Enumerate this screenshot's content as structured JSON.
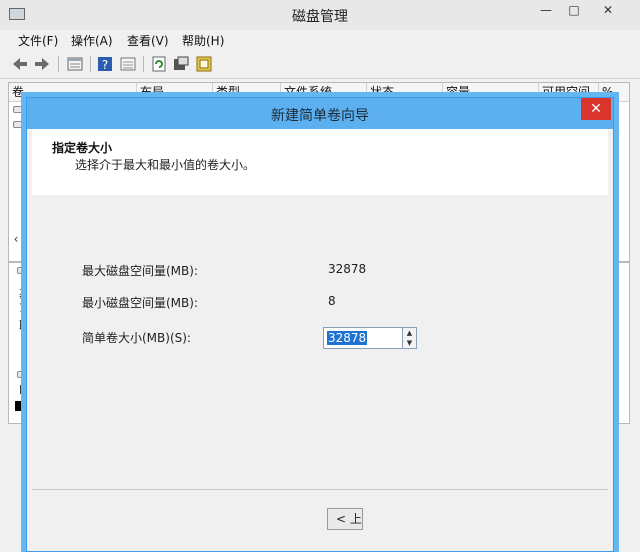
{
  "main_window": {
    "title": "磁盘管理",
    "controls": {
      "minimize": "—",
      "maximize": "□",
      "close": "✕"
    },
    "menu": [
      "文件(F)",
      "操作(A)",
      "查看(V)",
      "帮助(H)"
    ],
    "toolbar_icons": [
      "back-arrow-icon",
      "forward-arrow-icon",
      "properties-icon",
      "help-icon",
      "list-view-icon",
      "refresh-icon",
      "settings-icon",
      "wizard-icon"
    ],
    "columns": [
      "卷",
      "布局",
      "类型",
      "文件系统",
      "状态",
      "容量",
      "可用空间",
      "%"
    ],
    "scroll_left": "‹",
    "disk_area_fragments": [
      "基",
      "1",
      "联",
      "D"
    ]
  },
  "wizard": {
    "title": "新建简单卷向导",
    "close": "✕",
    "heading": "指定卷大小",
    "subheading": "选择介于最大和最小值的卷大小。",
    "max_label": "最大磁盘空间量(MB):",
    "max_value": "32878",
    "min_label": "最小磁盘空间量(MB):",
    "min_value": "8",
    "size_label": "简单卷大小(MB)(S):",
    "size_value": "32878",
    "spin_up": "▲",
    "spin_down": "▼",
    "back_button": "< 上"
  }
}
